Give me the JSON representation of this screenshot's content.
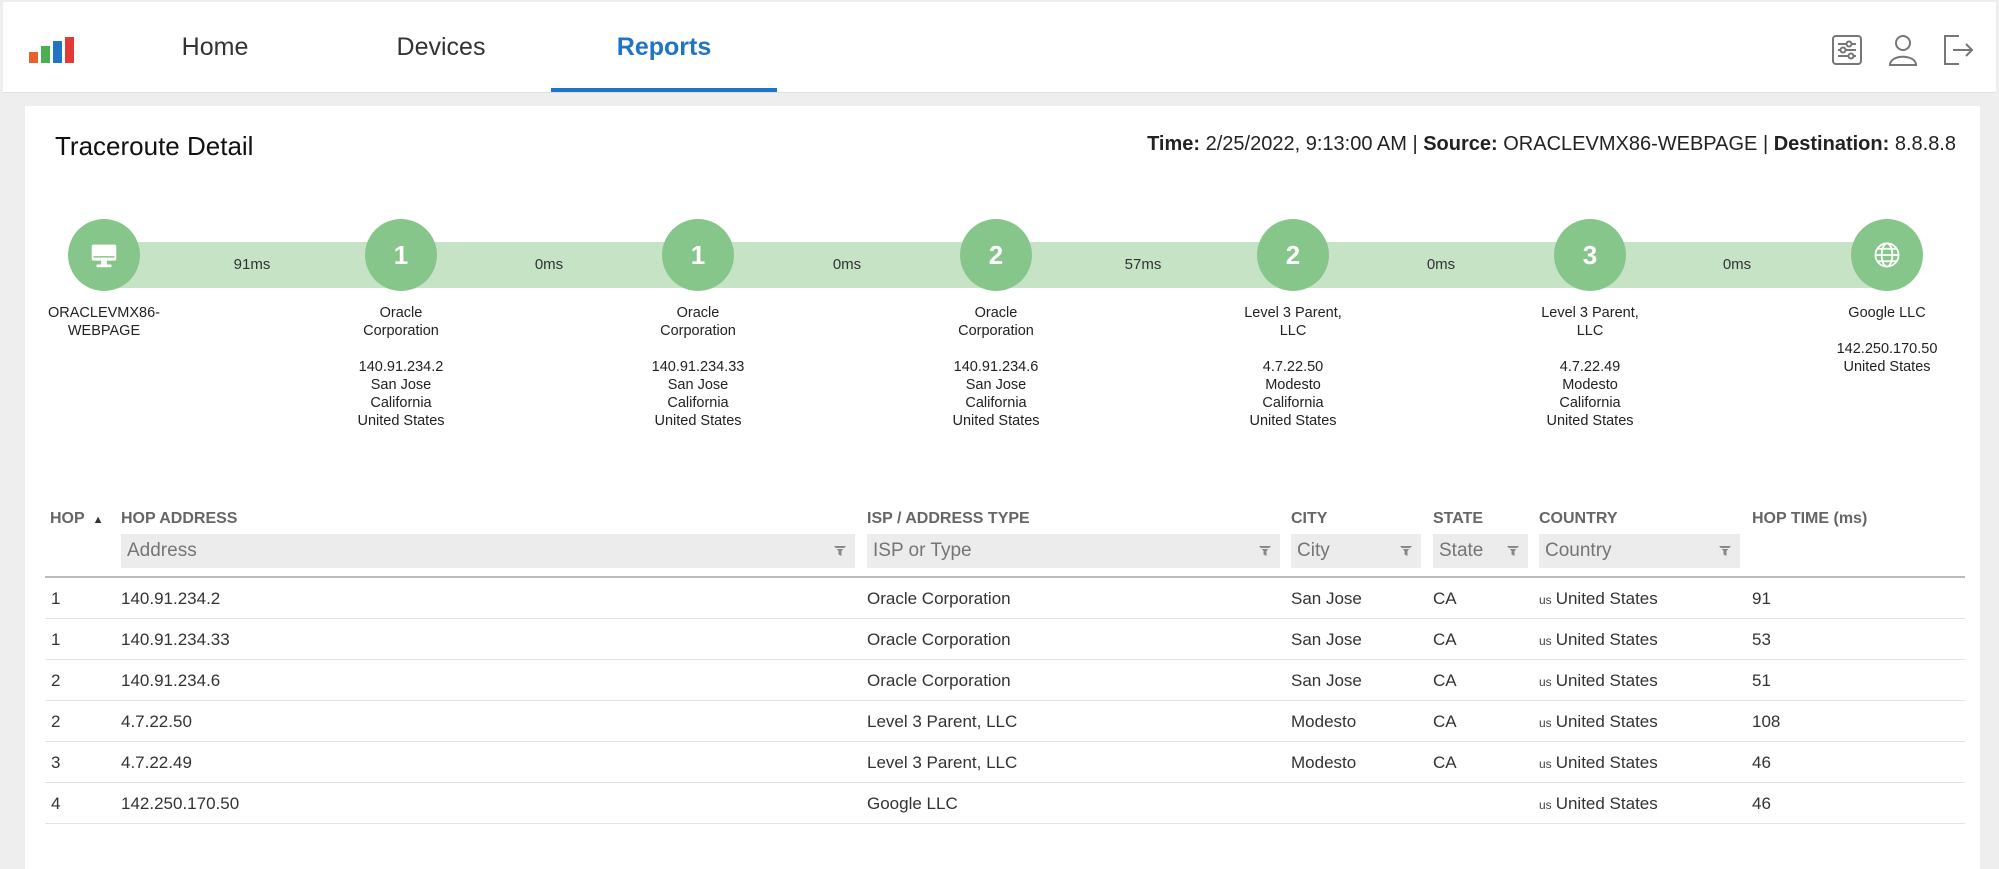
{
  "nav": {
    "tabs": [
      {
        "label": "Home"
      },
      {
        "label": "Devices"
      },
      {
        "label": "Reports",
        "active": true
      }
    ],
    "icons": [
      "settings-sliders-icon",
      "user-icon",
      "logout-icon"
    ],
    "accent_color": "#1f74c6"
  },
  "page": {
    "title": "Traceroute Detail",
    "time_label": "Time:",
    "time_value": "2/25/2022, 9:13:00 AM",
    "source_label": "Source:",
    "source_value": "ORACLEVMX86-WEBPAGE",
    "destination_label": "Destination:",
    "destination_value": "8.8.8.8"
  },
  "route": {
    "source": {
      "lines": [
        "ORACLEVMX86-",
        "WEBPAGE"
      ]
    },
    "hops": [
      {
        "number": "1",
        "latency": "91ms",
        "lines": [
          "Oracle",
          "Corporation",
          "",
          "140.91.234.2",
          "San Jose",
          "California",
          "United States"
        ]
      },
      {
        "number": "1",
        "latency": "0ms",
        "lines": [
          "Oracle",
          "Corporation",
          "",
          "140.91.234.33",
          "San Jose",
          "California",
          "United States"
        ]
      },
      {
        "number": "2",
        "latency": "0ms",
        "lines": [
          "Oracle",
          "Corporation",
          "",
          "140.91.234.6",
          "San Jose",
          "California",
          "United States"
        ]
      },
      {
        "number": "2",
        "latency": "57ms",
        "lines": [
          "Level 3 Parent,",
          "LLC",
          "",
          "4.7.22.50",
          "Modesto",
          "California",
          "United States"
        ]
      },
      {
        "number": "3",
        "latency": "0ms",
        "lines": [
          "Level 3 Parent,",
          "LLC",
          "",
          "4.7.22.49",
          "Modesto",
          "California",
          "United States"
        ]
      }
    ],
    "destination": {
      "latency": "0ms",
      "lines": [
        "Google LLC",
        "",
        "142.250.170.50",
        "United States"
      ]
    },
    "node_color": "#86c68b",
    "bar_color": "#c7e3c6"
  },
  "table": {
    "columns": {
      "hop": "HOP",
      "address": "HOP ADDRESS",
      "isp": "ISP / ADDRESS TYPE",
      "city": "CITY",
      "state": "STATE",
      "country": "COUNTRY",
      "time": "HOP TIME (ms)"
    },
    "filters": {
      "address": "Address",
      "isp": "ISP or Type",
      "city": "City",
      "state": "State",
      "country": "Country"
    },
    "rows": [
      {
        "hop": "1",
        "address": "140.91.234.2",
        "isp": "Oracle Corporation",
        "city": "San Jose",
        "state": "CA",
        "flag": "us",
        "country": "United States",
        "time": "91"
      },
      {
        "hop": "1",
        "address": "140.91.234.33",
        "isp": "Oracle Corporation",
        "city": "San Jose",
        "state": "CA",
        "flag": "us",
        "country": "United States",
        "time": "53"
      },
      {
        "hop": "2",
        "address": "140.91.234.6",
        "isp": "Oracle Corporation",
        "city": "San Jose",
        "state": "CA",
        "flag": "us",
        "country": "United States",
        "time": "51"
      },
      {
        "hop": "2",
        "address": "4.7.22.50",
        "isp": "Level 3 Parent, LLC",
        "city": "Modesto",
        "state": "CA",
        "flag": "us",
        "country": "United States",
        "time": "108"
      },
      {
        "hop": "3",
        "address": "4.7.22.49",
        "isp": "Level 3 Parent, LLC",
        "city": "Modesto",
        "state": "CA",
        "flag": "us",
        "country": "United States",
        "time": "46"
      },
      {
        "hop": "4",
        "address": "142.250.170.50",
        "isp": "Google LLC",
        "city": "",
        "state": "",
        "flag": "us",
        "country": "United States",
        "time": "46"
      }
    ]
  }
}
